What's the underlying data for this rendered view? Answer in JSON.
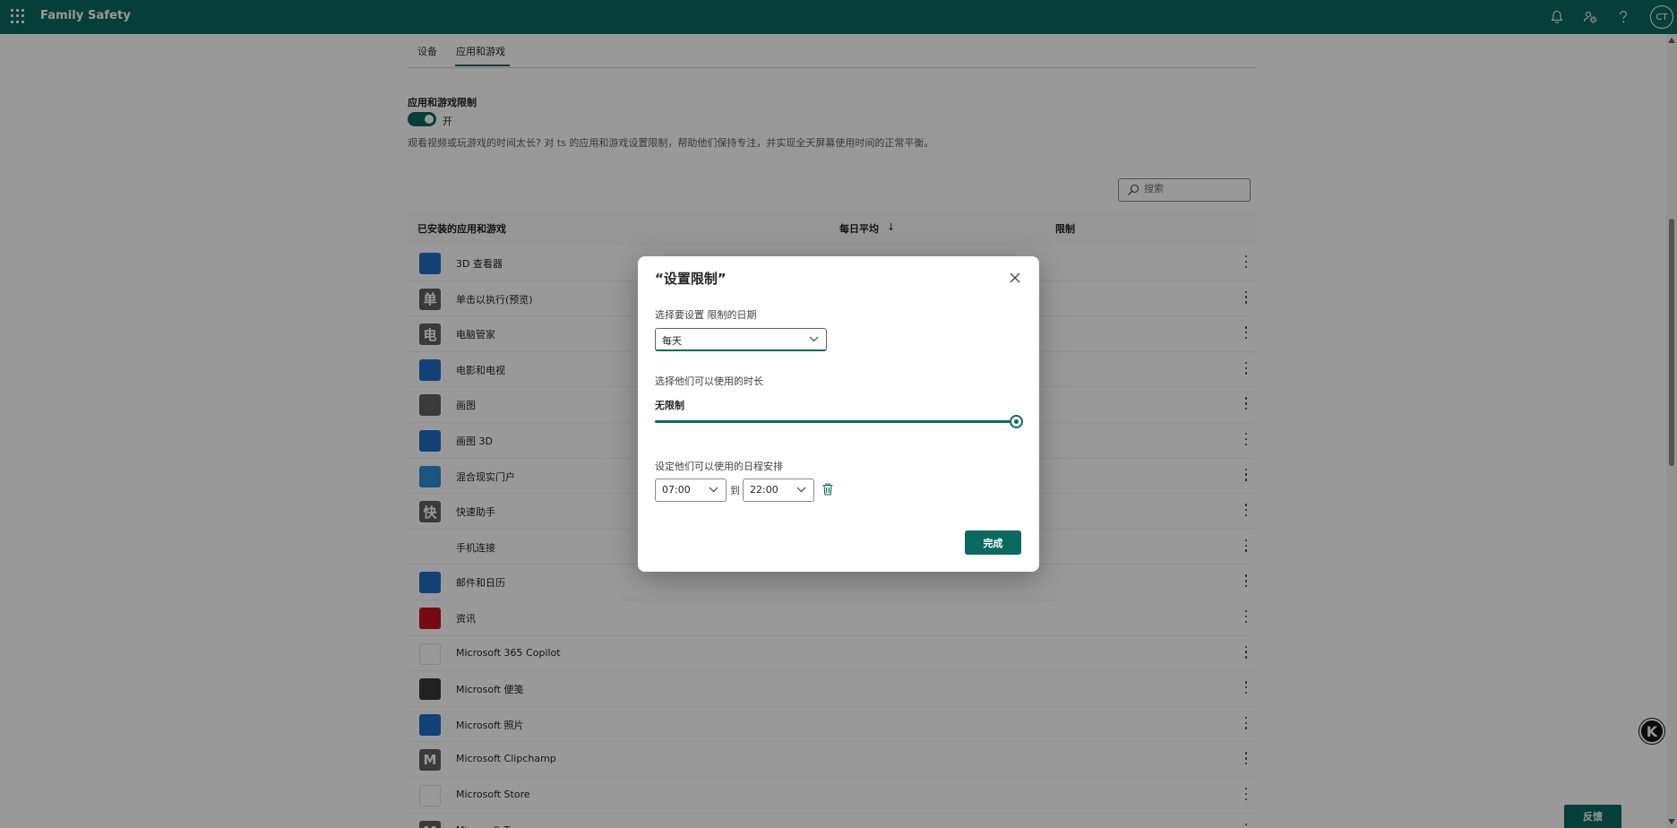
{
  "topbar": {
    "app_title": "Family Safety",
    "waffle_icon": "waffle-icon",
    "icons": [
      "bell-icon",
      "people-settings-icon",
      "help-icon"
    ],
    "avatar_initials": "CT",
    "brand_color": "#0b6a5f"
  },
  "tabs": [
    {
      "label": "设备",
      "active": false
    },
    {
      "label": "应用和游戏",
      "active": true
    }
  ],
  "section": {
    "title": "应用和游戏限制",
    "toggle_state": "开",
    "toggle_on": true,
    "description": "观看视频或玩游戏的时间太长? 对 ts 的应用和游戏设置限制，帮助他们保持专注，并实现全天屏幕使用时间的正常平衡。"
  },
  "search": {
    "placeholder": "搜索"
  },
  "table": {
    "headers": {
      "name": "已安装的应用和游戏",
      "avg": "每日平均",
      "sort_indicator": "↓",
      "limit": "限制"
    },
    "rows": [
      {
        "name": "3D 查看器",
        "icon": "3d-viewer-icon",
        "icon_color": "#1e6fc4",
        "glyph": ""
      },
      {
        "name": "单击以执行(预览)",
        "icon": "app-letter-icon",
        "icon_color": "#616161",
        "glyph": "单"
      },
      {
        "name": "电脑管家",
        "icon": "app-letter-icon",
        "icon_color": "#616161",
        "glyph": "电"
      },
      {
        "name": "电影和电视",
        "icon": "movies-tv-icon",
        "icon_color": "#1e6fc4",
        "glyph": ""
      },
      {
        "name": "画图",
        "icon": "paint-icon",
        "icon_color": "#616161",
        "glyph": ""
      },
      {
        "name": "画图 3D",
        "icon": "paint-3d-icon",
        "icon_color": "#1e6fc4",
        "glyph": ""
      },
      {
        "name": "混合现实门户",
        "icon": "mixed-reality-icon",
        "icon_color": "#2c8fd4",
        "glyph": ""
      },
      {
        "name": "快速助手",
        "icon": "app-letter-icon",
        "icon_color": "#616161",
        "glyph": "快"
      },
      {
        "name": "手机连接",
        "icon": "",
        "icon_color": "transparent",
        "glyph": ""
      },
      {
        "name": "邮件和日历",
        "icon": "outlook-icon",
        "icon_color": "#1e6fc4",
        "glyph": ""
      },
      {
        "name": "资讯",
        "icon": "news-icon",
        "icon_color": "#c50f1f",
        "glyph": ""
      },
      {
        "name": "Microsoft 365 Copilot",
        "icon": "office-icon",
        "icon_color": "#ffffff",
        "glyph": ""
      },
      {
        "name": "Microsoft 便笺",
        "icon": "sticky-notes-icon",
        "icon_color": "#3b3a39",
        "glyph": ""
      },
      {
        "name": "Microsoft 照片",
        "icon": "photos-icon",
        "icon_color": "#1e6fc4",
        "glyph": ""
      },
      {
        "name": "Microsoft Clipchamp",
        "icon": "app-letter-icon",
        "icon_color": "#616161",
        "glyph": "M"
      },
      {
        "name": "Microsoft Store",
        "icon": "store-icon",
        "icon_color": "#ffffff",
        "glyph": ""
      },
      {
        "name": "Microsoft To...",
        "icon": "app-letter-icon",
        "icon_color": "#616161",
        "glyph": "M"
      }
    ]
  },
  "dialog": {
    "title": "“设置限制”",
    "day_label": "选择要设置 限制的日期",
    "day_value": "每天",
    "duration_label": "选择他们可以使用的时长",
    "duration_value": "无限制",
    "duration_fraction": 1.0,
    "schedule_label": "设定他们可以使用的日程安排",
    "start_time": "07:00",
    "to_label": "到",
    "end_time": "22:00",
    "done_label": "完成"
  },
  "feedback_label": "反馈",
  "k_badge": "K"
}
